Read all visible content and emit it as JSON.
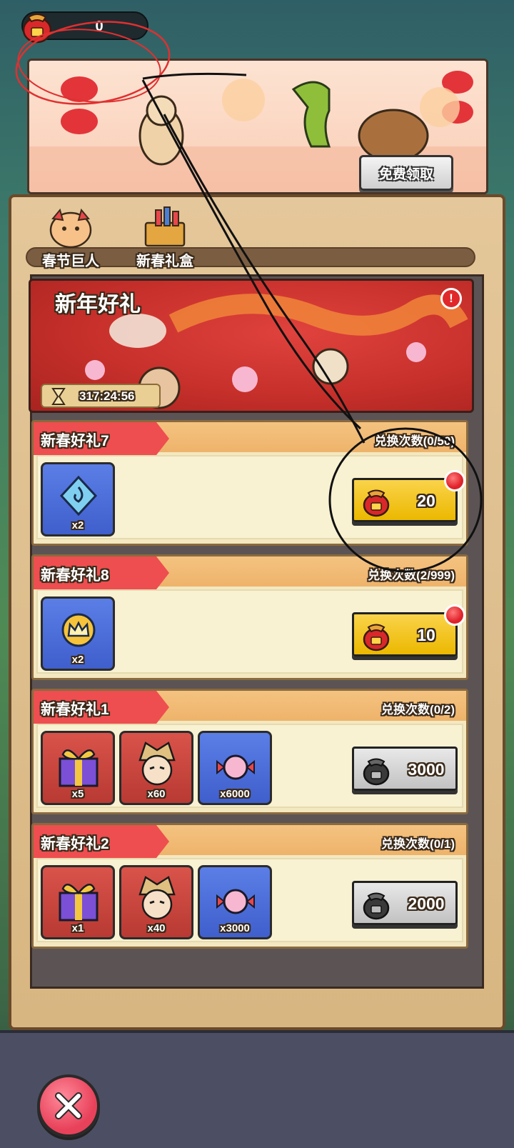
{
  "currency": {
    "amount": "0",
    "icon": "lucky-bag-icon"
  },
  "top_banner": {
    "free_button": "免费领取"
  },
  "tabs": [
    {
      "label": "春节巨人",
      "icon": "dragon-giant-icon"
    },
    {
      "label": "新春礼盒",
      "icon": "firework-box-icon"
    }
  ],
  "event": {
    "title": "新年好礼",
    "timer": "317:24:56",
    "alert": "!"
  },
  "cards": [
    {
      "title": "新春好礼7",
      "count": "兑换次数(0/50)",
      "items": [
        {
          "icon": "spiral-gem-icon",
          "qty": "x2",
          "bg": "blue"
        }
      ],
      "price": "20",
      "button_style": "gold",
      "has_dot": true
    },
    {
      "title": "新春好礼8",
      "count": "兑换次数(2/999)",
      "items": [
        {
          "icon": "crown-icon",
          "qty": "x2",
          "bg": "blue"
        }
      ],
      "price": "10",
      "button_style": "gold",
      "has_dot": true
    },
    {
      "title": "新春好礼1",
      "count": "兑换次数(0/2)",
      "items": [
        {
          "icon": "gift-box-icon",
          "qty": "x5",
          "bg": "red"
        },
        {
          "icon": "hero-portrait-icon",
          "qty": "x60",
          "bg": "red"
        },
        {
          "icon": "candy-icon",
          "qty": "x6000",
          "bg": "blue"
        }
      ],
      "price": "3000",
      "button_style": "grey",
      "has_dot": false
    },
    {
      "title": "新春好礼2",
      "count": "兑换次数(0/1)",
      "items": [
        {
          "icon": "gift-box-icon",
          "qty": "x1",
          "bg": "red"
        },
        {
          "icon": "hero-portrait-icon",
          "qty": "x40",
          "bg": "red"
        },
        {
          "icon": "candy-icon",
          "qty": "x3000",
          "bg": "blue"
        }
      ],
      "price": "2000",
      "button_style": "grey",
      "has_dot": false
    }
  ],
  "colors": {
    "ribbon": "#ee4e4f",
    "gold_button": "#fad34a",
    "board": "#e4c79a"
  },
  "close_button": {
    "icon": "close-icon"
  }
}
